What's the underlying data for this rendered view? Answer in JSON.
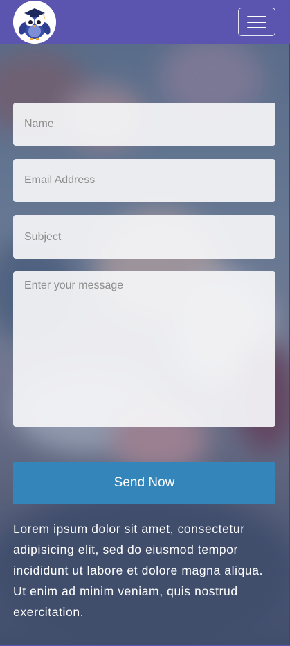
{
  "header": {
    "logo_icon": "owl-graduate-icon",
    "menu_icon": "hamburger-menu-icon",
    "bar_color": "#5b55b0"
  },
  "form": {
    "name_placeholder": "Name",
    "email_placeholder": "Email Address",
    "subject_placeholder": "Subject",
    "message_placeholder": "Enter your message",
    "send_label": "Send Now",
    "send_color": "#3385ba"
  },
  "description": "Lorem ipsum dolor sit amet, consectetur adipisicing elit, sed do eiusmod tempor incididunt ut labore et dolore magna aliqua. Ut enim ad minim veniam, quis nostrud exercitation."
}
